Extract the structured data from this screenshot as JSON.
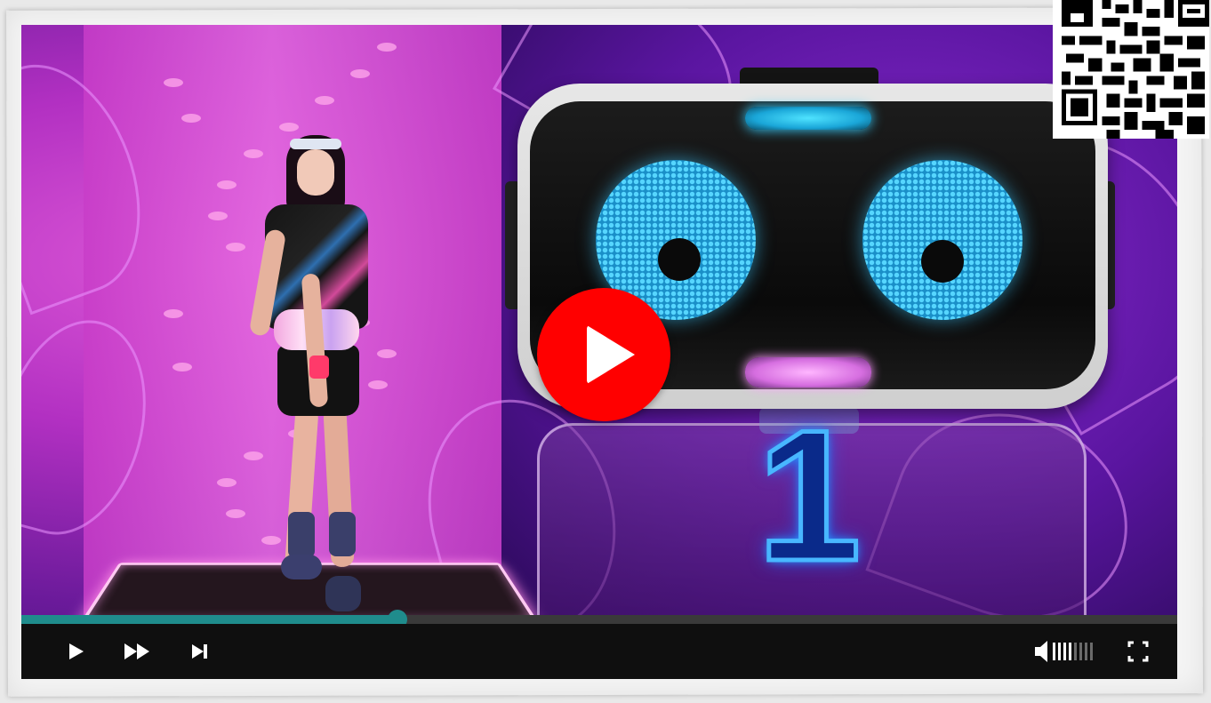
{
  "video": {
    "countdown_number": "1",
    "play_overlay_icon": "youtube-play-icon",
    "brand_color": "#ff0000"
  },
  "player": {
    "progress_fraction": 0.325,
    "progress_color": "#1f8c8c",
    "volume_level_bars_filled": 4,
    "volume_level_bars_total": 8,
    "controls": {
      "play_icon": "play-icon",
      "fast_forward_icon": "fast-forward-icon",
      "skip_next_icon": "skip-next-icon",
      "volume_icon": "volume-icon",
      "fullscreen_icon": "fullscreen-icon"
    }
  },
  "qr_code": {
    "icon": "qr-code-icon"
  }
}
